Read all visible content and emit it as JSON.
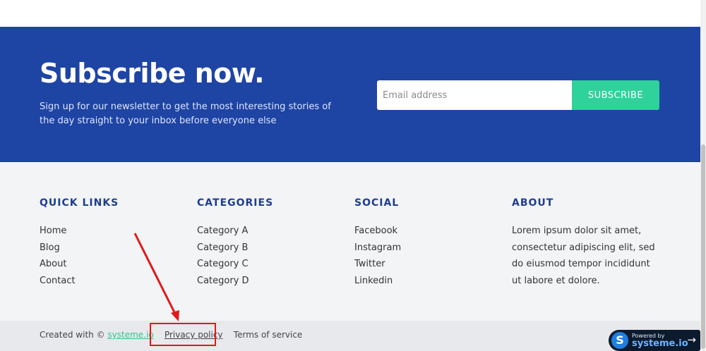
{
  "subscribe": {
    "title": "Subscribe now.",
    "text": "Sign up for our newsletter to get the most interesting stories of the day straight to your inbox before everyone else",
    "email_placeholder": "Email address",
    "button_label": "SUBSCRIBE"
  },
  "footer": {
    "quick_links": {
      "heading": "QUICK LINKS",
      "items": [
        "Home",
        "Blog",
        "About",
        "Contact"
      ]
    },
    "categories": {
      "heading": "CATEGORIES",
      "items": [
        "Category A",
        "Category B",
        "Category C",
        "Category D"
      ]
    },
    "social": {
      "heading": "SOCIAL",
      "items": [
        "Facebook",
        "Instagram",
        "Twitter",
        "Linkedin"
      ]
    },
    "about": {
      "heading": "ABOUT",
      "text": "Lorem ipsum dolor sit amet, consectetur adipiscing elit, sed do eiusmod tempor incididunt ut labore et dolore."
    }
  },
  "bottom": {
    "created_with": "Created with ©",
    "systeme_link": "systeme.io",
    "privacy_link": "Privacy policy",
    "terms_link": "Terms of service"
  },
  "badge": {
    "powered_by": "Powered by",
    "brand": "systeme.io",
    "logo_letter": "S",
    "arrow": "→"
  },
  "colors": {
    "subscribe_bg": "#1e44a4",
    "subscribe_button": "#2fd29a",
    "heading_blue": "#1e3e8f",
    "annotation_red": "#e0191b"
  }
}
